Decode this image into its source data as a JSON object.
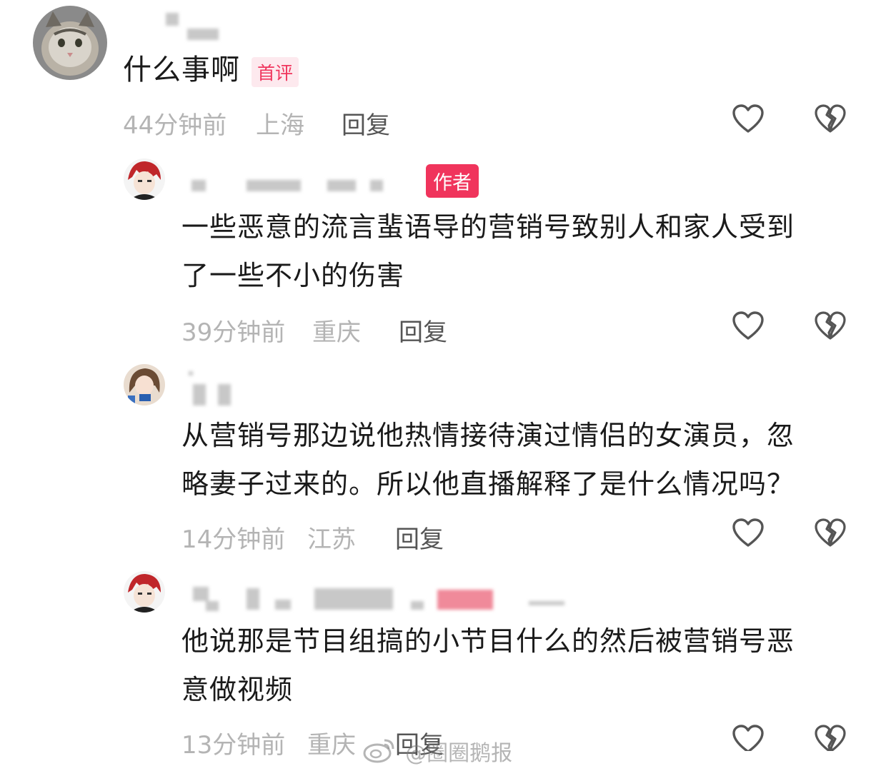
{
  "comments": [
    {
      "text_lines": [
        "什么事啊"
      ],
      "tag": "首评",
      "time": "44分钟前",
      "location": "上海",
      "reply_label": "回复"
    },
    {
      "tag": "作者",
      "text_lines": [
        "一些恶意的流言蜚语导的营销号致别人和家人受到",
        "了一些不小的伤害"
      ],
      "time": "39分钟前",
      "location": "重庆",
      "reply_label": "回复"
    },
    {
      "text_lines": [
        "从营销号那边说他热情接待演过情侣的女演员，忽",
        "略妻子过来的。所以他直播解释了是什么情况吗？"
      ],
      "time": "14分钟前",
      "location": "江苏",
      "reply_label": "回复"
    },
    {
      "text_lines": [
        "他说那是节目组搞的小节目什么的然后被营销号恶",
        "意做视频"
      ],
      "time": "13分钟前",
      "location": "重庆",
      "reply_label": "回复"
    }
  ],
  "watermark": "@圈圈鹅报",
  "colors": {
    "accent": "#f0345c",
    "meta_gray": "#b4b4b4",
    "icon_gray": "#555555"
  },
  "icons": [
    "heart-outline-icon",
    "broken-heart-icon",
    "weibo-logo-icon"
  ]
}
